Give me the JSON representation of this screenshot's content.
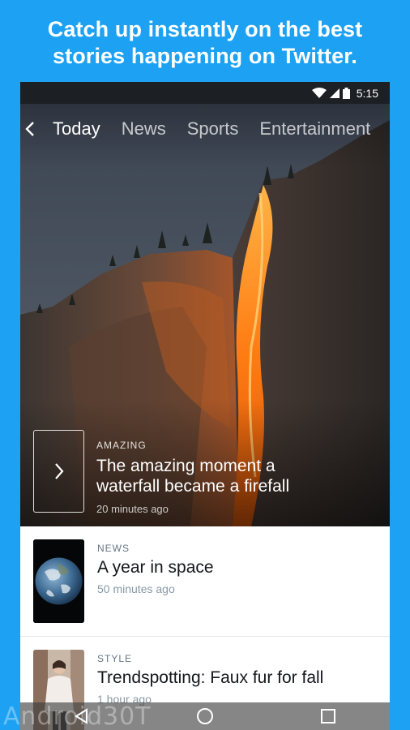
{
  "promo": {
    "line1": "Catch up instantly on the best",
    "line2": "stories happening on Twitter."
  },
  "status_bar": {
    "time": "5:15"
  },
  "tabs": [
    {
      "label": "Today",
      "active": true
    },
    {
      "label": "News",
      "active": false
    },
    {
      "label": "Sports",
      "active": false
    },
    {
      "label": "Entertainment",
      "active": false
    }
  ],
  "hero": {
    "category": "AMAZING",
    "title_line1": "The amazing moment a",
    "title_line2": "waterfall became a firefall",
    "time": "20 minutes ago"
  },
  "stories": [
    {
      "category": "NEWS",
      "title": "A year in space",
      "time": "50 minutes ago"
    },
    {
      "category": "STYLE",
      "title": "Trendspotting: Faux fur for fall",
      "time": "1 hour ago"
    }
  ],
  "watermark": "Android30T",
  "colors": {
    "brand": "#1da1f2",
    "firefall": "#ff8a1a"
  }
}
